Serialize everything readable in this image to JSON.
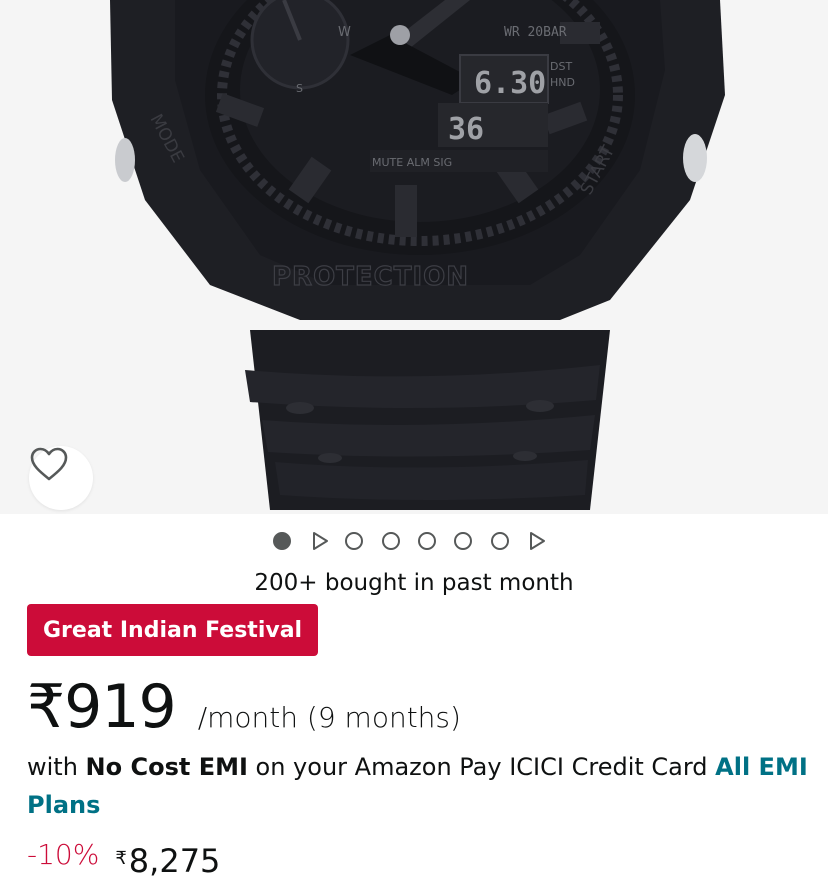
{
  "gallery": {
    "image_alt": "Black resin G-Shock analog-digital watch",
    "dial_labels": {
      "mode": "MODE",
      "start": "START",
      "protection": "PROTECTION",
      "water_resist": "WR 20BAR",
      "dst": "DST",
      "hnd": "HND",
      "time": "6.30",
      "seconds": "36",
      "sub_labels": "MUTE  ALM  SIG",
      "w": "W",
      "s": "S"
    },
    "wishlist_icon": "heart-outline-icon",
    "slides": [
      "image",
      "video",
      "image",
      "image",
      "image",
      "image",
      "image",
      "video"
    ],
    "active_slide": 0
  },
  "social_proof": "200+ bought in past month",
  "deal_badge": {
    "label": "Great Indian Festival",
    "color": "#cc0c39"
  },
  "emi": {
    "price": "₹919",
    "period": "/month (9 months)",
    "line_prefix": "with ",
    "line_bold": "No Cost EMI",
    "line_suffix": " on your Amazon Pay ICICI Credit Card ",
    "link_label": "All EMI Plans",
    "link_color": "#007185"
  },
  "pricing": {
    "discount": "-10%",
    "currency_symbol": "₹",
    "amount": "8,275"
  }
}
